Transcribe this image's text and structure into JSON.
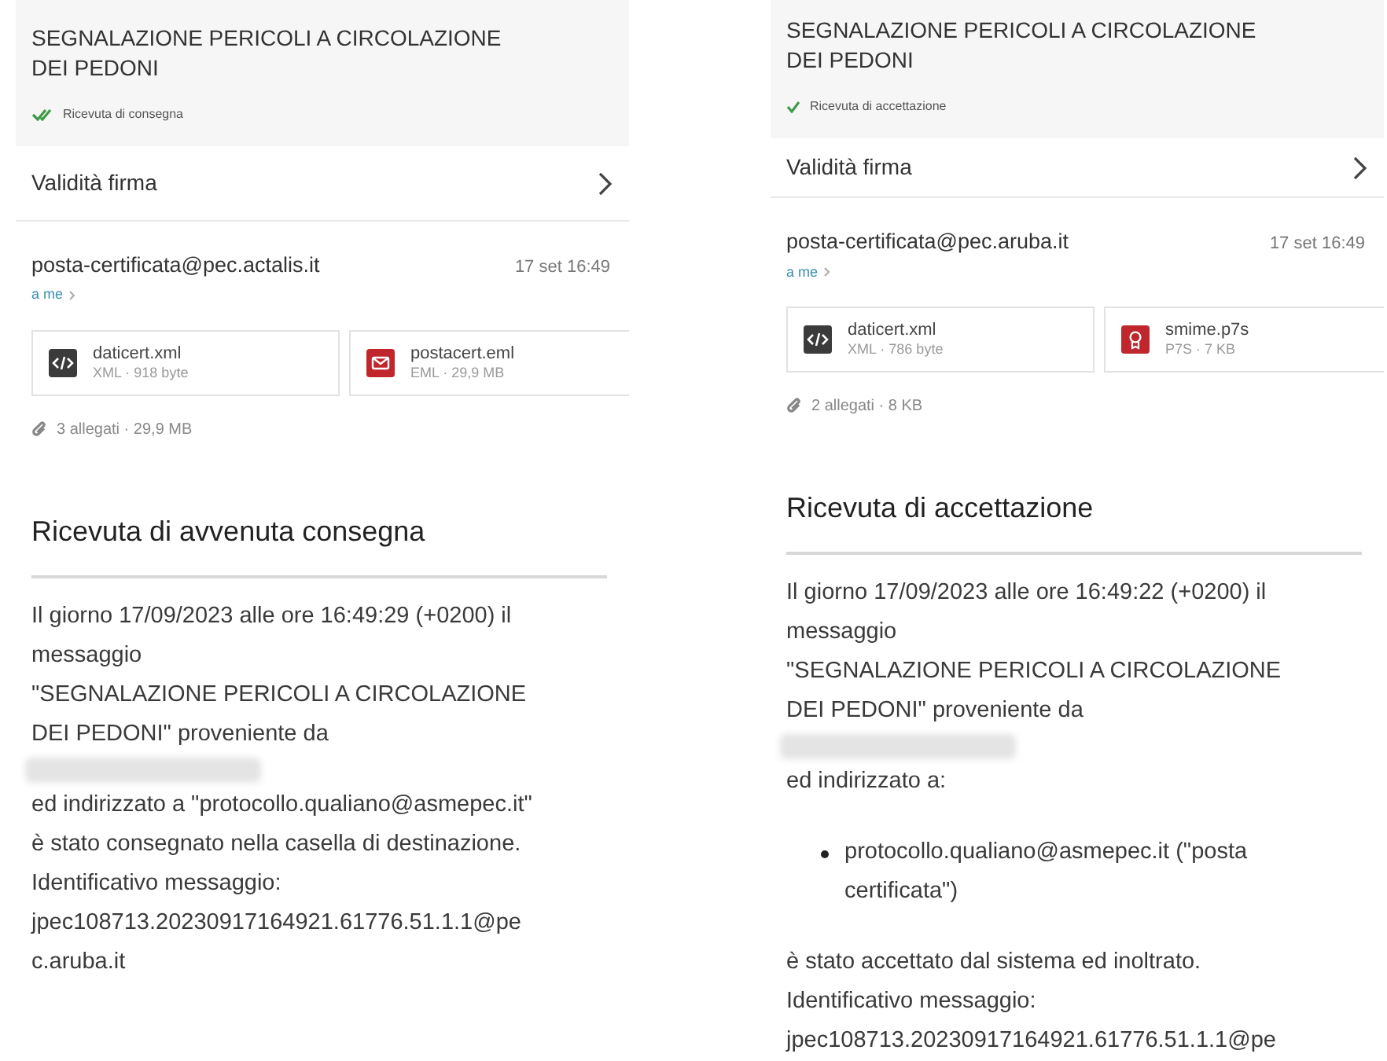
{
  "panels": [
    {
      "subject": "SEGNALAZIONE PERICOLI A CIRCOLAZIONE DEI PEDONI",
      "status": {
        "kind": "delivered",
        "label": "Ricevuta di consegna"
      },
      "signature_row": "Validità firma",
      "sender": "posta-certificata@pec.actalis.it",
      "date": "17 set 16:49",
      "recipient": "a me",
      "attachments": [
        {
          "kind": "code",
          "name": "daticert.xml",
          "meta": "XML · 918 byte"
        },
        {
          "kind": "mail",
          "name": "postacert.eml",
          "meta": "EML · 29,9 MB"
        }
      ],
      "attachments_summary": "3 allegati · 29,9 MB",
      "heading": "Ricevuta di avvenuta consegna",
      "body": [
        {
          "kind": "text",
          "lines": [
            "Il giorno 17/09/2023 alle ore 16:49:29 (+0200) il",
            "messaggio",
            "\"SEGNALAZIONE PERICOLI A CIRCOLAZIONE",
            "DEI PEDONI\" proveniente da"
          ]
        },
        {
          "kind": "redacted"
        },
        {
          "kind": "text",
          "lines": [
            "ed indirizzato a \"protocollo.qualiano@asmepec.it\"",
            "è stato consegnato nella casella di destinazione.",
            "Identificativo messaggio:",
            "jpec108713.20230917164921.61776.51.1.1@pe",
            "c.aruba.it"
          ]
        }
      ]
    },
    {
      "subject": "SEGNALAZIONE PERICOLI A CIRCOLAZIONE DEI PEDONI",
      "status": {
        "kind": "accepted",
        "label": "Ricevuta di accettazione"
      },
      "signature_row": "Validità firma",
      "sender": "posta-certificata@pec.aruba.it",
      "date": "17 set 16:49",
      "recipient": "a me",
      "attachments": [
        {
          "kind": "code",
          "name": "daticert.xml",
          "meta": "XML · 786 byte"
        },
        {
          "kind": "seal",
          "name": "smime.p7s",
          "meta": "P7S · 7 KB"
        }
      ],
      "attachments_summary": "2 allegati · 8 KB",
      "heading": "Ricevuta di accettazione",
      "body": [
        {
          "kind": "text",
          "lines": [
            "Il giorno 17/09/2023 alle ore 16:49:22 (+0200) il",
            "messaggio",
            "\"SEGNALAZIONE PERICOLI A CIRCOLAZIONE",
            "DEI PEDONI\" proveniente da"
          ]
        },
        {
          "kind": "redacted"
        },
        {
          "kind": "text",
          "lines": [
            "ed indirizzato a:"
          ]
        },
        {
          "kind": "bullet",
          "lines": [
            "protocollo.qualiano@asmepec.it (\"posta",
            "certificata\")"
          ]
        },
        {
          "kind": "text",
          "lines": [
            "è stato accettato dal sistema ed inoltrato.",
            "Identificativo messaggio:",
            "jpec108713.20230917164921.61776.51.1.1@pe"
          ]
        }
      ]
    }
  ]
}
